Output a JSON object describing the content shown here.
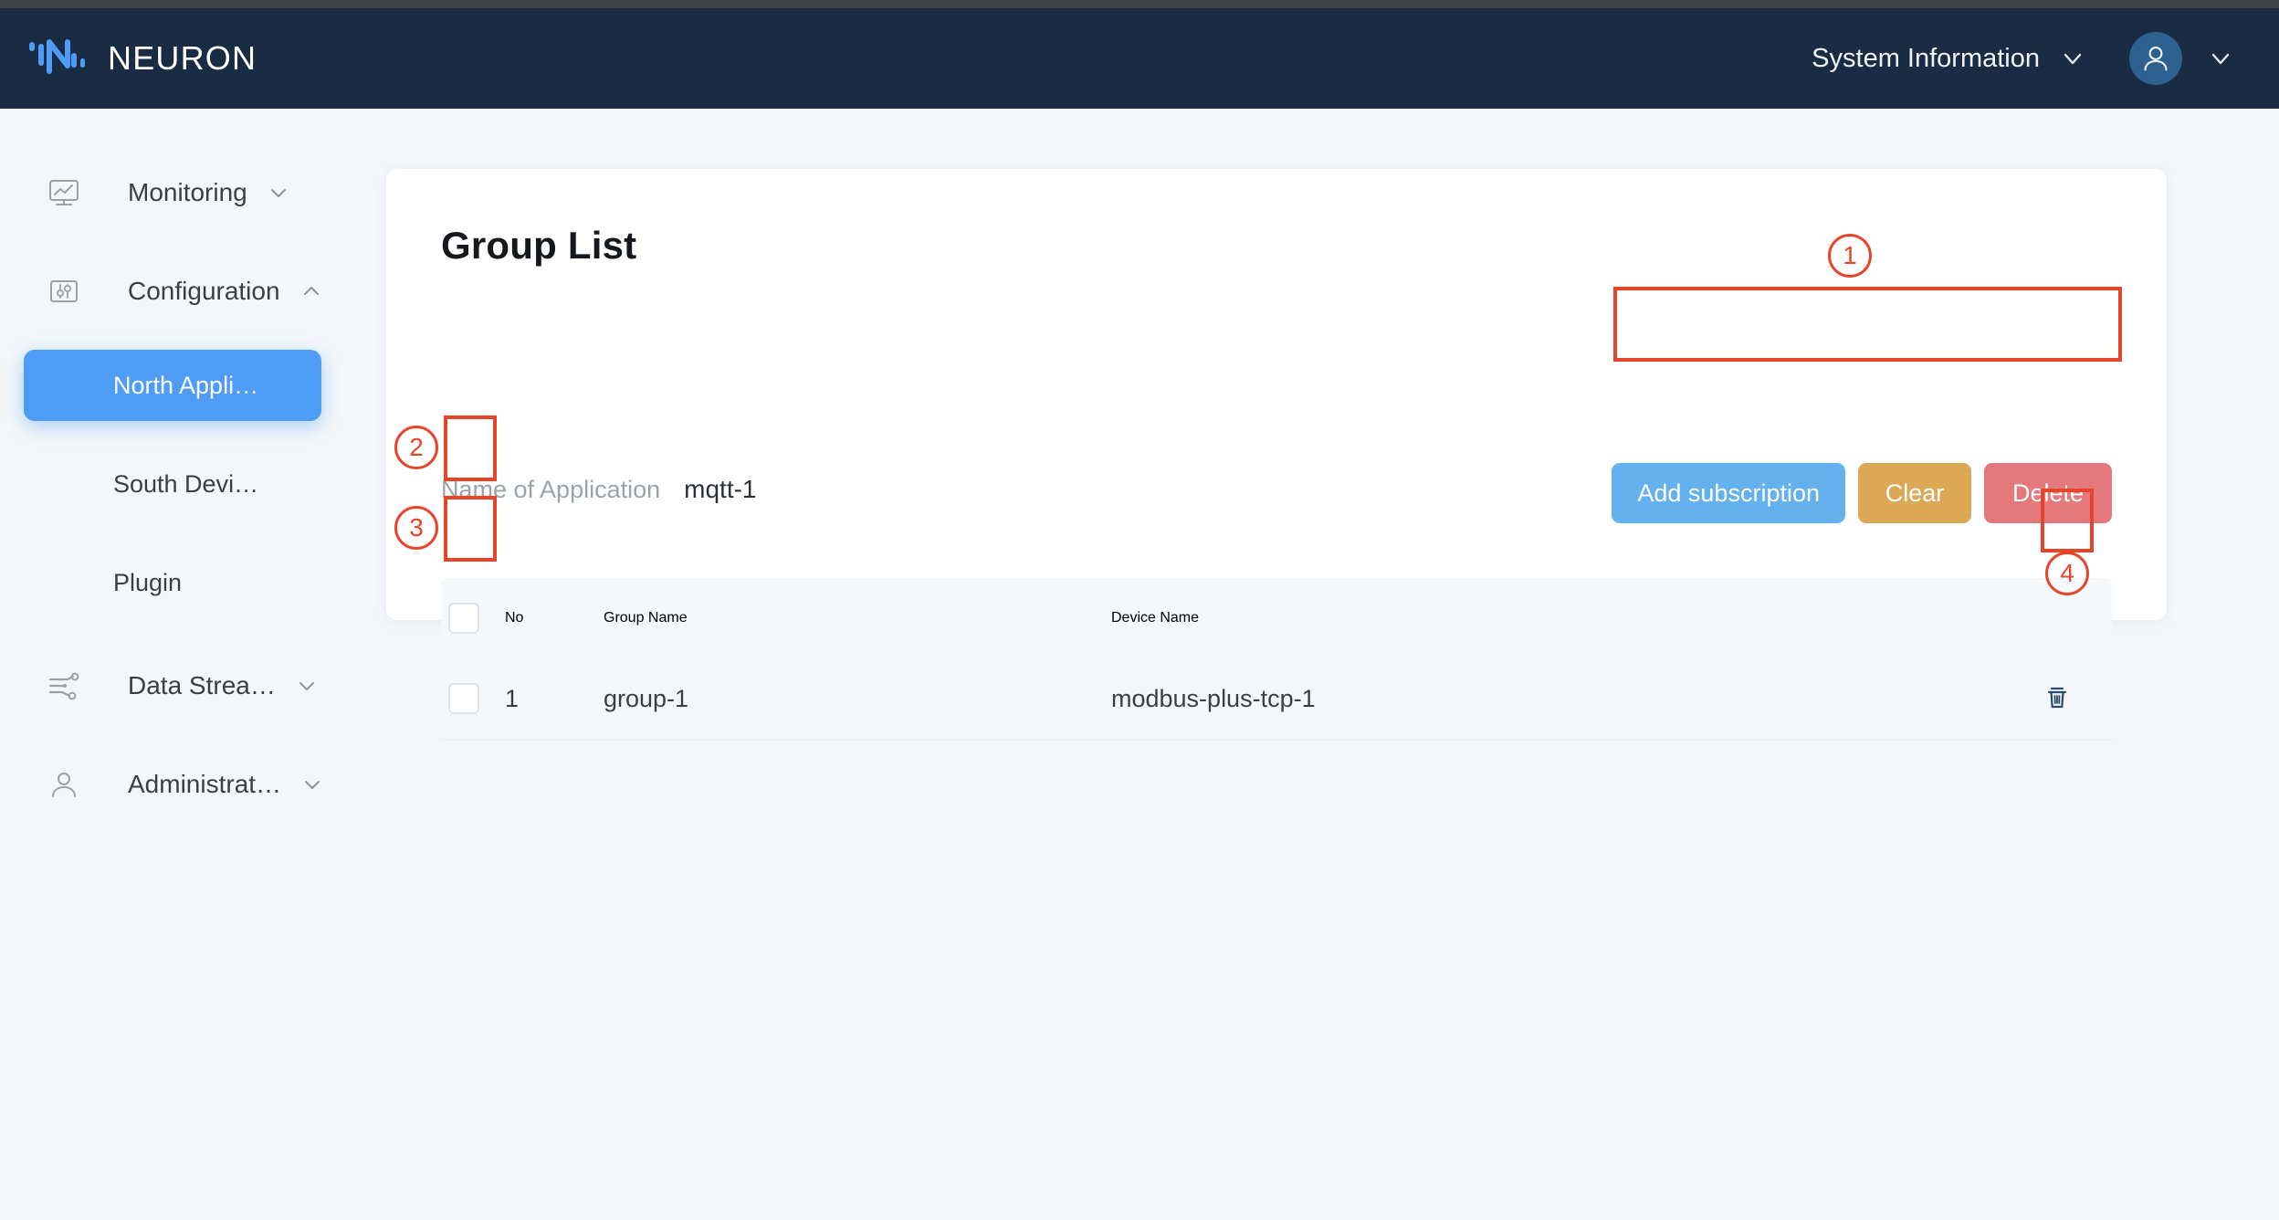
{
  "header": {
    "brand": "NEURON",
    "system_information_label": "System Information",
    "logo_icon": "neuron-logo-icon",
    "sysinfo_caret_icon": "chevron-down-icon",
    "avatar_icon": "user-avatar-icon",
    "avatar_caret_icon": "chevron-down-icon",
    "brand_blue": "#4e9cf5",
    "bar_color": "#1a2c43"
  },
  "sidebar": {
    "items": [
      {
        "label": "Monitoring",
        "icon": "monitor-chart-icon",
        "caret": "chevron-down-icon",
        "expanded": false
      },
      {
        "label": "Configuration",
        "icon": "sliders-icon",
        "caret": "chevron-up-icon",
        "expanded": true
      },
      {
        "label": "Data Strea…",
        "icon": "data-stream-icon",
        "caret": "chevron-down-icon",
        "expanded": false
      },
      {
        "label": "Administrat…",
        "icon": "user-admin-icon",
        "caret": "chevron-down-icon",
        "expanded": false
      }
    ],
    "sub_items": [
      {
        "label": "North Appli…",
        "active": true
      },
      {
        "label": "South Devi…",
        "active": false
      },
      {
        "label": "Plugin",
        "active": false
      }
    ],
    "active_color": "#4e9cf5"
  },
  "main": {
    "title": "Group List",
    "meta": {
      "label": "Name of Application",
      "value": "mqtt-1"
    },
    "buttons": [
      {
        "label": "Add subscription",
        "style": "primary",
        "color": "#64b1ef"
      },
      {
        "label": "Clear",
        "style": "warn",
        "color": "#dda855"
      },
      {
        "label": "Delete",
        "style": "danger",
        "color": "#e3797c"
      }
    ],
    "table": {
      "columns": [
        "No",
        "Group Name",
        "Device Name"
      ],
      "select_all_checked": false,
      "rows": [
        {
          "checked": false,
          "no": "1",
          "group_name": "group-1",
          "device_name": "modbus-plus-tcp-1",
          "action_icon": "trash-icon"
        }
      ]
    }
  },
  "annotations": {
    "color": "#e8442a",
    "markers": [
      {
        "id": "1",
        "target": "button-group"
      },
      {
        "id": "2",
        "target": "select-all-checkbox"
      },
      {
        "id": "3",
        "target": "row-checkbox"
      },
      {
        "id": "4",
        "target": "row-delete-button"
      }
    ]
  }
}
